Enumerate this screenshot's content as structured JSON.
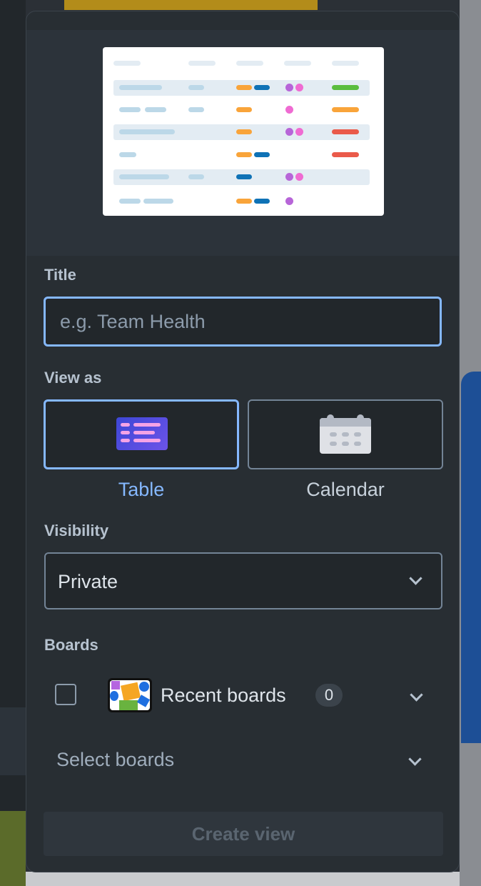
{
  "form": {
    "title_label": "Title",
    "title_placeholder": "e.g. Team Health",
    "title_value": "",
    "view_as_label": "View as",
    "view_options": [
      {
        "label": "Table",
        "selected": true,
        "icon": "table-icon"
      },
      {
        "label": "Calendar",
        "selected": false,
        "icon": "calendar-icon"
      }
    ],
    "visibility_label": "Visibility",
    "visibility_value": "Private",
    "boards_label": "Boards",
    "recent_boards_label": "Recent boards",
    "recent_boards_count": "0",
    "select_boards_placeholder": "Select boards",
    "create_button_label": "Create view"
  },
  "colors": {
    "accent": "#85b8ff",
    "popover_bg": "#282e33",
    "input_bg": "#22272b",
    "text_primary": "#dee4ea",
    "text_muted": "#8c9bab"
  },
  "icons": [
    "chevron-down-icon",
    "table-icon",
    "calendar-icon",
    "board-thumbnail"
  ]
}
